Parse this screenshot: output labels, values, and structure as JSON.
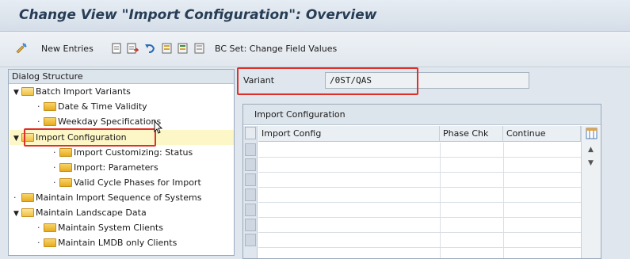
{
  "title": "Change View \"Import Configuration\": Overview",
  "toolbar": {
    "new_entries": "New Entries",
    "bc_set": "BC Set: Change Field Values"
  },
  "dialog": {
    "header": "Dialog Structure",
    "items": [
      {
        "label": "Batch Import Variants",
        "level": 0,
        "type": "open"
      },
      {
        "label": "Date & Time Validity",
        "level": 1,
        "type": "leaf"
      },
      {
        "label": "Weekday Specifications",
        "level": 1,
        "type": "leaf"
      },
      {
        "label": "Import Configuration",
        "level": 1,
        "type": "open",
        "selected": true
      },
      {
        "label": "Import Customizing: Status",
        "level": 2,
        "type": "leaf"
      },
      {
        "label": "Import: Parameters",
        "level": 2,
        "type": "leaf"
      },
      {
        "label": "Valid Cycle Phases for Import",
        "level": 2,
        "type": "leaf"
      },
      {
        "label": "Maintain Import Sequence of Systems",
        "level": 0,
        "type": "leaf"
      },
      {
        "label": "Maintain Landscape Data",
        "level": 0,
        "type": "open"
      },
      {
        "label": "Maintain System Clients",
        "level": 1,
        "type": "leaf"
      },
      {
        "label": "Maintain LMDB only Clients",
        "level": 1,
        "type": "leaf"
      }
    ]
  },
  "variant": {
    "label": "Variant",
    "value": "/0ST/QAS"
  },
  "table": {
    "title": "Import Configuration",
    "columns": [
      "Import Config",
      "Phase Chk",
      "Continue"
    ]
  },
  "colors": {
    "highlight": "#e0302a",
    "selected_row": "#fdf6c6",
    "title_text": "#263d55"
  }
}
